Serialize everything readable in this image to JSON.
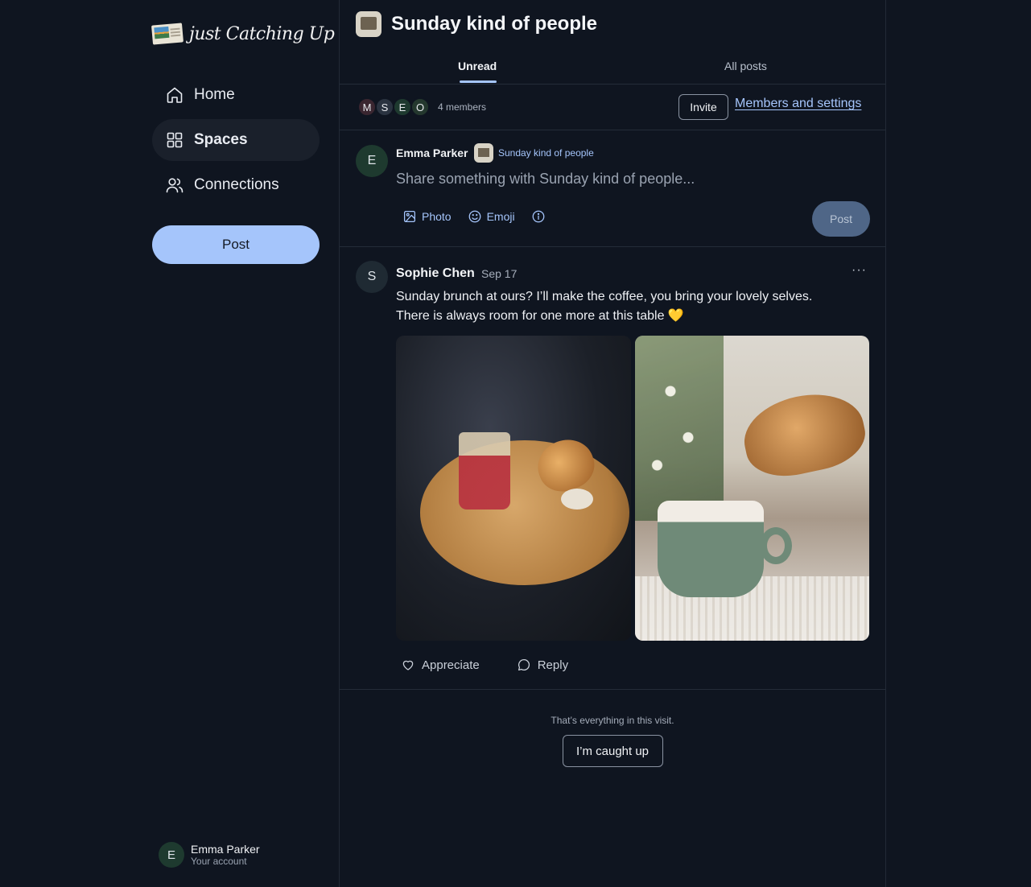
{
  "app": {
    "logo_text": "just Catching Up"
  },
  "sidebar": {
    "items": [
      {
        "label": "Home",
        "icon": "home-icon"
      },
      {
        "label": "Spaces",
        "icon": "grid-icon",
        "active": true
      },
      {
        "label": "Connections",
        "icon": "people-icon"
      }
    ],
    "post_label": "Post"
  },
  "account": {
    "initial": "E",
    "name": "Emma Parker",
    "subtitle": "Your account"
  },
  "space": {
    "title": "Sunday kind of people",
    "tabs": [
      {
        "label": "Unread",
        "active": true
      },
      {
        "label": "All posts"
      }
    ],
    "members": {
      "initials": [
        "M",
        "S",
        "E",
        "O"
      ],
      "count_label": "4 members",
      "invite_label": "Invite",
      "settings_link": "Members and settings"
    }
  },
  "composer": {
    "avatar_initial": "E",
    "author": "Emma Parker",
    "space_name": "Sunday kind of people",
    "placeholder": "Share something with Sunday kind of people...",
    "tools": {
      "photo": "Photo",
      "emoji": "Emoji"
    },
    "post_label": "Post"
  },
  "post": {
    "avatar_initial": "S",
    "author": "Sophie Chen",
    "date": "Sep 17",
    "body_line1": "Sunday brunch at ours? I’ll make the coffee, you bring your lovely selves.",
    "body_line2": "There is always room for one more at this table 💛",
    "more": "···",
    "reactions": {
      "appreciate": "Appreciate",
      "reply": "Reply"
    }
  },
  "footer": {
    "caught_text": "That’s everything in this visit.",
    "caught_button": "I’m caught up"
  },
  "colors": {
    "accent": "#a5c5fb",
    "background": "#0f1520",
    "surface": "#1a202b"
  }
}
